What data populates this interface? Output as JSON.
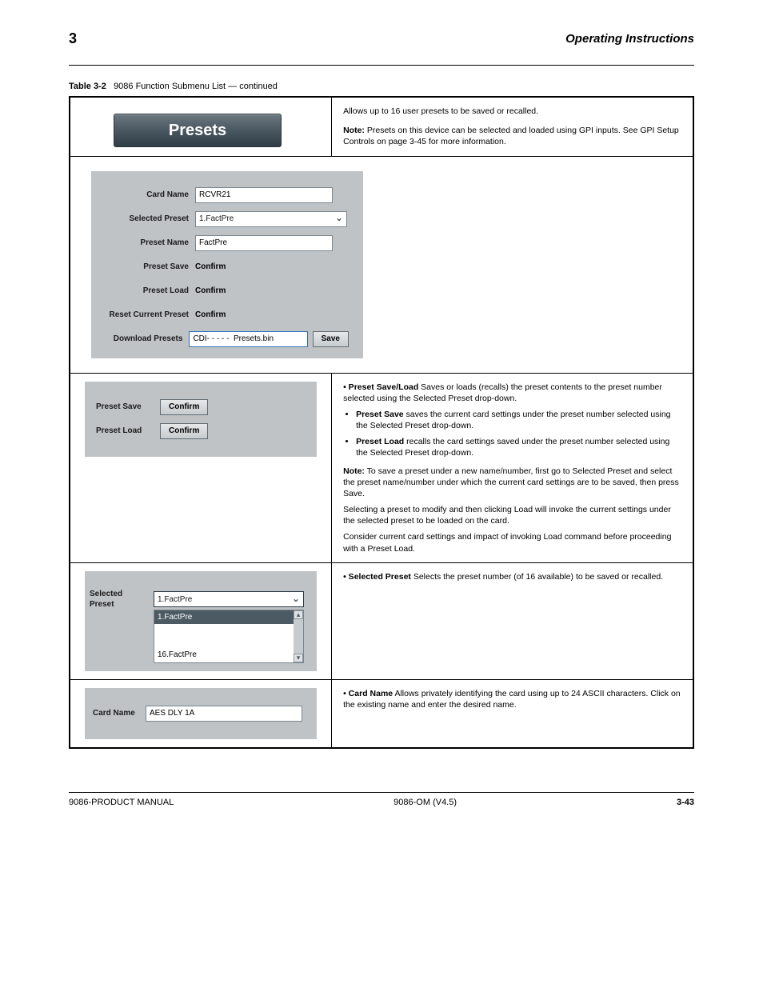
{
  "header": {
    "page_number": "3",
    "title": "Operating Instructions"
  },
  "table_caption": {
    "prefix": "Table 3-2",
    "title": "9086 Function Submenu List — continued"
  },
  "presets": {
    "tab_label": "Presets",
    "intro": "Allows up to 16 user presets to be saved or recalled.",
    "note1_label": "Note:",
    "note1_text": "Presets on this device can be selected and loaded using GPI inputs. See GPI Setup Controls on page 3-45 for more information.",
    "panel": {
      "card_name_label": "Card Name",
      "card_name_value": "RCVR21",
      "selected_preset_label": "Selected Preset",
      "selected_preset_value": "1.FactPre",
      "preset_name_label": "Preset Name",
      "preset_name_value": "FactPre",
      "preset_save_label": "Preset Save",
      "preset_save_btn": "Confirm",
      "preset_load_label": "Preset Load",
      "preset_load_btn": "Confirm",
      "reset_label": "Reset Current Preset",
      "reset_btn": "Confirm",
      "download_label": "Download Presets",
      "download_value": "CDI- - - - -  Presets.bin",
      "save_btn": "Save"
    }
  },
  "save_load_block": {
    "preset_save_label": "Preset Save",
    "preset_load_label": "Preset Load",
    "confirm_btn": "Confirm",
    "heading": "• Preset Save/Load",
    "body": "Saves or loads (recalls) the preset contents to the preset number selected using the Selected Preset drop-down.",
    "b1_label": "Preset Save",
    "b1_text": " saves the current card settings under the preset number selected using the Selected Preset drop-down.",
    "b2_label": "Preset Load",
    "b2_text": " recalls the card settings saved under the preset number selected using the Selected Preset drop-down.",
    "note_label": "Note:",
    "note_paras": [
      "To save a preset under a new name/number, first go to Selected Preset and select the preset name/number under which the current card settings are to be saved, then press Save.",
      "Selecting a preset to modify and then clicking Load will invoke the current settings under the selected preset to be loaded on the card.",
      "Consider current card settings and impact of invoking Load command before proceeding with a Preset Load."
    ]
  },
  "selected_preset_block": {
    "label": "Selected Preset",
    "value": "1.FactPre",
    "list_first": "1.FactPre",
    "list_last": "16.FactPre",
    "heading": "• Selected Preset",
    "body": "Selects the preset number (of 16 available) to be saved or recalled."
  },
  "card_name_block": {
    "label": "Card Name",
    "value": "AES DLY 1A",
    "heading": "• Card Name",
    "body": "Allows privately identifying the card using up to 24 ASCII characters. Click on the existing name and enter the desired name."
  },
  "footer": {
    "left": "9086-PRODUCT MANUAL",
    "center": "9086-OM (V4.5)",
    "right": "3-43"
  }
}
